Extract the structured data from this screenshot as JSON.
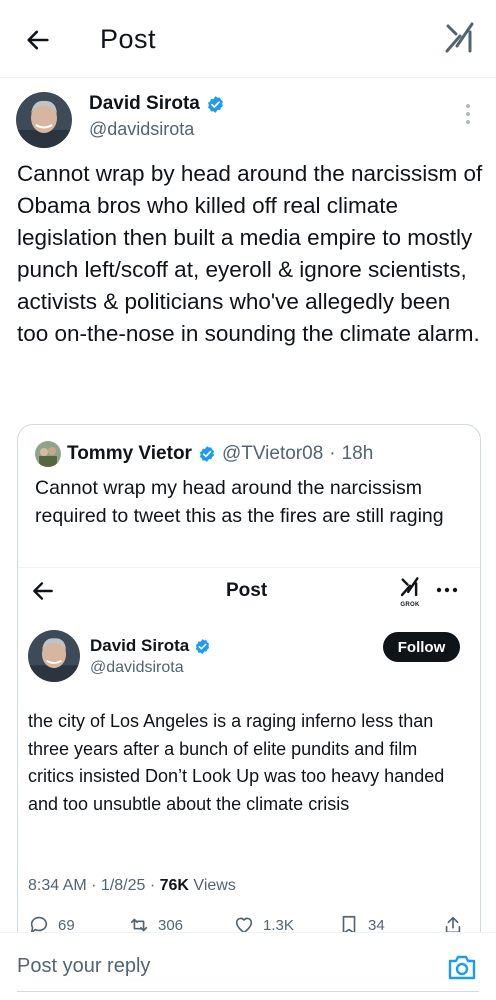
{
  "header": {
    "title": "Post",
    "back_icon": "arrow-left-icon",
    "grok_icon": "grok-icon"
  },
  "tweet": {
    "author_name": "David Sirota",
    "author_handle": "@davidsirota",
    "verified": true,
    "text": "Cannot wrap by head around the narcissism of Obama bros who killed off real climate legislation then built a media empire to mostly punch left/scoff at, eyeroll & ignore scientists, activists & politicians who've allegedly been too on-the-nose in sounding the climate alarm."
  },
  "quote": {
    "author_name": "Tommy Vietor",
    "author_handle": "@TVietor08",
    "separator": "·",
    "time": "18h",
    "text": "Cannot wrap my head around the narcissism required to tweet this as the fires are still raging",
    "embed": {
      "title": "Post",
      "grok_label": "GROK",
      "author_name": "David Sirota",
      "author_handle": "@davidsirota",
      "follow_label": "Follow",
      "text": "the city of Los Angeles is a raging inferno less than three years after a bunch of elite pundits and film critics insisted Don’t Look Up was too heavy handed and too unsubtle about the climate crisis",
      "meta_prefix": "8:34 AM · 1/8/25 · ",
      "views_count": "76K",
      "views_label": " Views",
      "stats": {
        "replies": "69",
        "reposts": "306",
        "likes": "1.3K",
        "bookmarks": "34"
      }
    }
  },
  "reply": {
    "placeholder": "Post your reply"
  },
  "colors": {
    "text": "#0f1419",
    "secondary": "#536471",
    "verified": "#1d9bf0",
    "border": "#cfd9de",
    "camera": "#1d9bf0"
  }
}
